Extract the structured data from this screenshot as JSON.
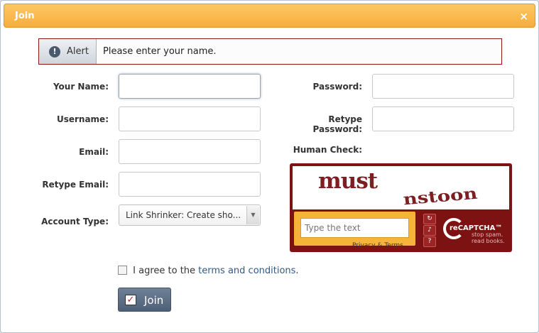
{
  "dialog": {
    "title": "Join",
    "close_icon": "×"
  },
  "alert": {
    "tag": "Alert",
    "message": "Please enter your name."
  },
  "form": {
    "name_label": "Your Name:",
    "username_label": "Username:",
    "email_label": "Email:",
    "retype_email_label": "Retype Email:",
    "account_type_label": "Account Type:",
    "account_type_value": "Link Shrinker: Create sho...",
    "password_label": "Password:",
    "retype_password_label": "Retype Password:",
    "human_check_label": "Human Check:"
  },
  "captcha": {
    "word1": "must",
    "word2": "nstoon",
    "input_placeholder": "Type the text",
    "privacy_text": "Privacy & Terms",
    "logo_text": "reCAPTCHA™",
    "tagline_1": "stop spam.",
    "tagline_2": "read books."
  },
  "agree": {
    "prefix": "I agree to the",
    "link": "terms and conditions",
    "suffix": "."
  },
  "join_button": {
    "label": "Join"
  },
  "colors": {
    "titlebar": "#f7ad3c",
    "captcha_bg": "#7d1212",
    "join_btn": "#5a6c82",
    "link": "#2f5a86"
  }
}
